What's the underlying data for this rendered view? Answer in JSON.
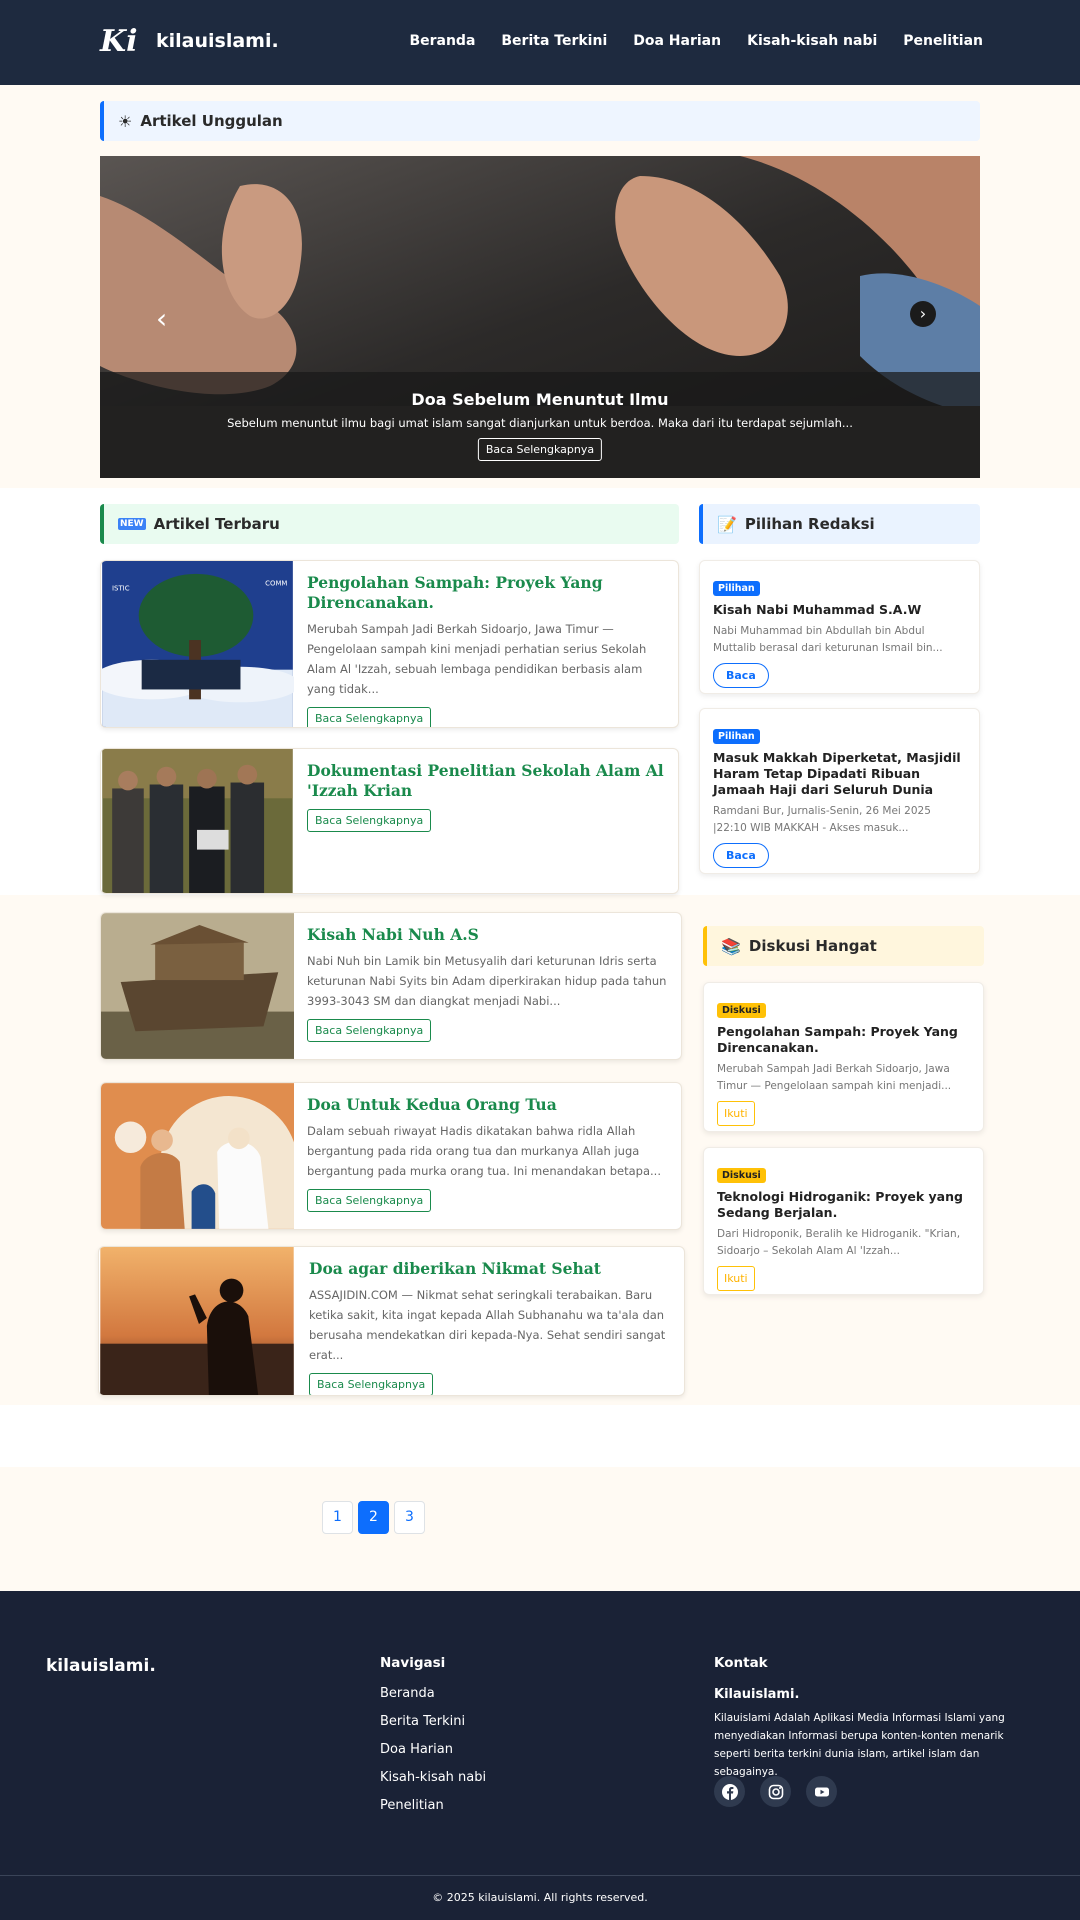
{
  "header": {
    "brand": "kilauislami.",
    "logo_glyph": "Ki",
    "nav": [
      "Beranda",
      "Berita Terkini",
      "Doa Harian",
      "Kisah-kisah nabi",
      "Penelitian"
    ]
  },
  "featured": {
    "heading": "Artikel Unggulan",
    "heading_icon": "sun-icon",
    "slide": {
      "title": "Doa Sebelum Menuntut Ilmu",
      "text": "Sebelum menuntut ilmu bagi umat islam sangat dianjurkan untuk berdoa. Maka dari itu terdapat sejumlah...",
      "button": "Baca Selengkapnya"
    }
  },
  "latest": {
    "heading": "Artikel Terbaru",
    "heading_icon": "new-icon",
    "read_more": "Baca Selengkapnya",
    "articles": [
      {
        "title": "Pengolahan Sampah: Proyek Yang Direncanakan.",
        "excerpt": "Merubah Sampah Jadi Berkah Sidoarjo, Jawa Timur — Pengelolaan sampah kini menjadi perhatian serius Sekolah Alam Al 'Izzah, sebuah lembaga pendidikan berbasis alam yang tidak...",
        "button": "Baca Selengkapnya"
      },
      {
        "title": "Dokumentasi Penelitian Sekolah Alam Al 'Izzah Krian",
        "excerpt": "",
        "button": "Baca Selengkapnya"
      },
      {
        "title": "Kisah Nabi Nuh A.S",
        "excerpt": "Nabi Nuh bin Lamik bin Metusyalih dari keturunan Idris serta keturunan Nabi Syits bin Adam diperkirakan hidup pada tahun 3993-3043 SM dan diangkat menjadi Nabi...",
        "button": "Baca Selengkapnya"
      },
      {
        "title": "Doa Untuk Kedua Orang Tua",
        "excerpt": "Dalam sebuah riwayat Hadis dikatakan bahwa ridla Allah bergantung pada rida orang tua dan murkanya Allah juga bergantung pada murka orang tua. Ini menandakan betapa...",
        "button": "Baca Selengkapnya"
      },
      {
        "title": "Doa agar diberikan Nikmat Sehat",
        "excerpt": "ASSAJIDIN.COM — Nikmat sehat seringkali terabaikan. Baru ketika sakit, kita ingat kepada Allah Subhanahu wa ta'ala dan berusaha mendekatkan diri kepada-Nya. Sehat sendiri sangat erat...",
        "button": "Baca Selengkapnya"
      }
    ]
  },
  "editors_pick": {
    "heading": "Pilihan Redaksi",
    "heading_icon": "memo-icon",
    "items": [
      {
        "badge": "Pilihan",
        "title": "Kisah Nabi Muhammad S.A.W",
        "text": "Nabi Muhammad bin Abdullah bin Abdul Muttalib berasal dari keturunan Ismail bin...",
        "button": "Baca"
      },
      {
        "badge": "Pilihan",
        "title": "Masuk Makkah Diperketat, Masjidil Haram Tetap Dipadati Ribuan Jamaah Haji dari Seluruh Dunia",
        "text": "Ramdani Bur, Jurnalis-Senin, 26 Mei 2025 |22:10 WIB MAKKAH - Akses masuk...",
        "button": "Baca"
      }
    ]
  },
  "hot_discussion": {
    "heading": "Diskusi Hangat",
    "heading_icon": "books-icon",
    "items": [
      {
        "badge": "Diskusi",
        "title": "Pengolahan Sampah: Proyek Yang Direncanakan.",
        "text": "Merubah Sampah Jadi Berkah Sidoarjo, Jawa Timur — Pengelolaan sampah kini menjadi...",
        "button": "Ikuti"
      },
      {
        "badge": "Diskusi",
        "title": "Teknologi Hidroganik: Proyek yang Sedang Berjalan.",
        "text": "Dari Hidroponik, Beralih ke Hidroganik. \"Krian, Sidoarjo – Sekolah Alam Al 'Izzah...",
        "button": "Ikuti"
      }
    ]
  },
  "pagination": {
    "pages": [
      "1",
      "2",
      "3"
    ],
    "active": "2"
  },
  "footer": {
    "brand": "kilauislami.",
    "nav_title": "Navigasi",
    "nav": [
      "Beranda",
      "Berita Terkini",
      "Doa Harian",
      "Kisah-kisah nabi",
      "Penelitian"
    ],
    "contact_title": "Kontak",
    "contact_name": "Kilauislami.",
    "contact_text": "Kilauislami Adalah Aplikasi Media Informasi Islami yang menyediakan Informasi berupa konten-konten menarik seperti berita terkini dunia islam, artikel islam dan sebagainya.",
    "socials": [
      "facebook-icon",
      "instagram-icon",
      "youtube-icon"
    ],
    "copyright": "© 2025 kilauislami. All rights reserved."
  },
  "colors": {
    "header_bg": "#1e2a3f",
    "accent_green": "#1a8a4c",
    "accent_blue": "#0d6efd",
    "accent_yellow": "#ffc107",
    "page_bg": "#fffaf3"
  }
}
